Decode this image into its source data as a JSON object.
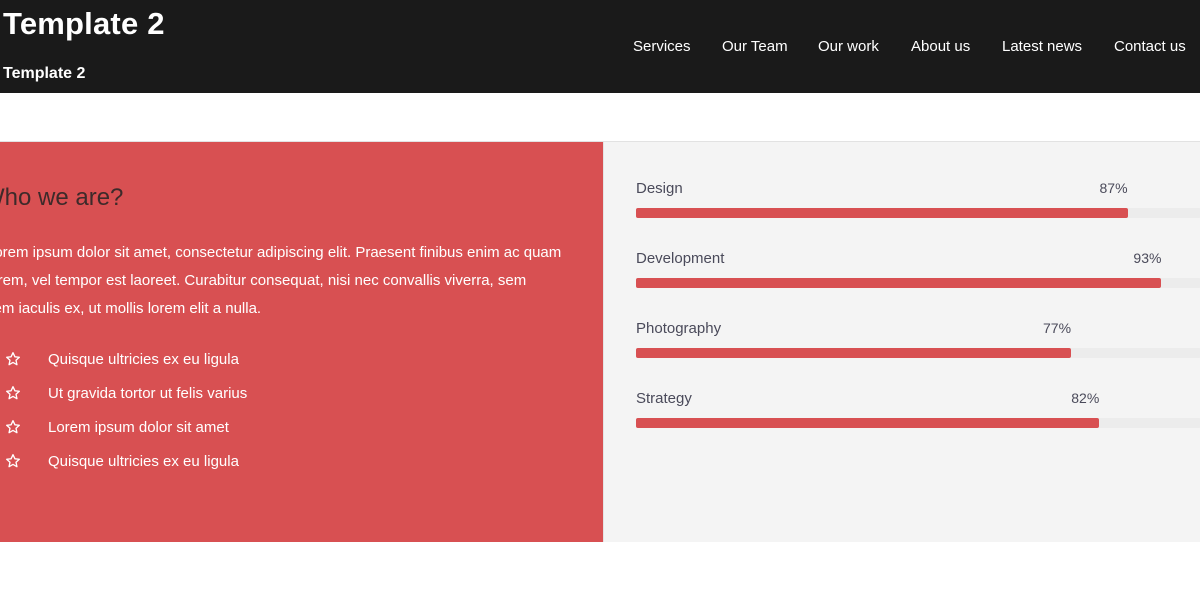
{
  "header": {
    "site_title": "Template 2",
    "tagline": "Template 2",
    "nav": [
      {
        "label": "Services"
      },
      {
        "label": "Our Team"
      },
      {
        "label": "Our work"
      },
      {
        "label": "About us"
      },
      {
        "label": "Latest news"
      },
      {
        "label": "Contact us"
      }
    ]
  },
  "about": {
    "title": "Who we are?",
    "paragraph_lines": [
      "Lorem ipsum dolor sit amet, consectetur adipiscing elit. Praesent finibus enim ac quam",
      "lorem, vel tempor est laoreet. Curabitur consequat, nisi nec convallis viverra, sem",
      "sem iaculis ex, ut mollis lorem elit a nulla."
    ],
    "features": [
      {
        "icon": "star-outline-icon",
        "label": "Quisque ultricies ex eu ligula"
      },
      {
        "icon": "star-outline-icon",
        "label": "Ut gravida tortor ut felis varius"
      },
      {
        "icon": "star-outline-icon",
        "label": "Lorem ipsum dolor sit amet"
      },
      {
        "icon": "star-outline-icon",
        "label": "Quisque ultricies ex eu ligula"
      }
    ]
  },
  "skills": [
    {
      "name": "Design",
      "percent": 87,
      "percent_label": "87%"
    },
    {
      "name": "Development",
      "percent": 93,
      "percent_label": "93%"
    },
    {
      "name": "Photography",
      "percent": 77,
      "percent_label": "77%"
    },
    {
      "name": "Strategy",
      "percent": 82,
      "percent_label": "82%"
    }
  ],
  "colors": {
    "header_bg": "#1a1a1a",
    "accent": "#d85052",
    "panel_grey": "#f4f4f4"
  }
}
